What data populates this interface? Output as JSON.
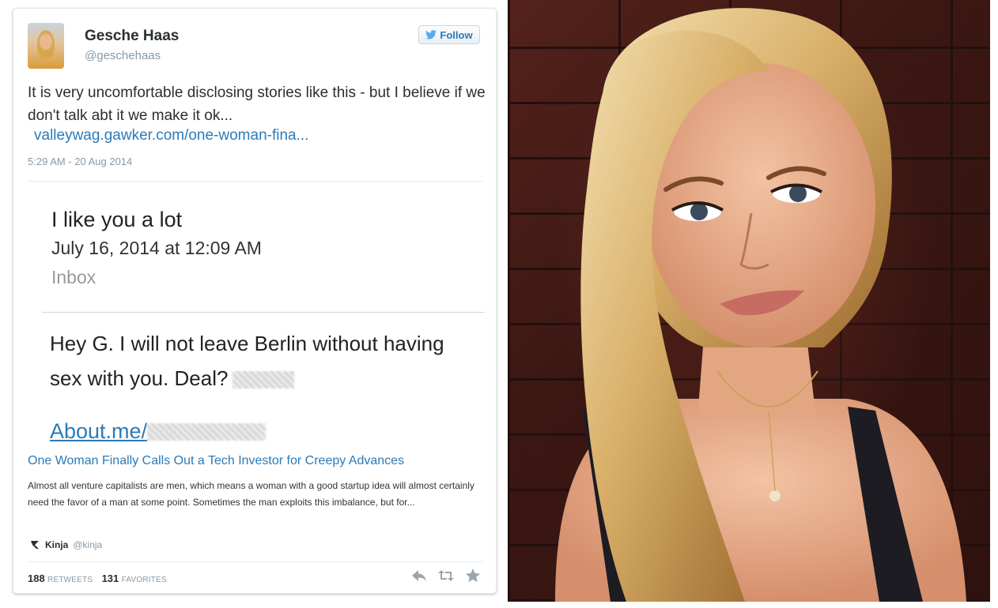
{
  "tweet": {
    "author_name": "Gesche Haas",
    "author_handle": "@geschehaas",
    "follow_label": "Follow",
    "text": "It is very uncomfortable disclosing stories like this - but I believe if we don't talk abt it we make it ok...",
    "link": "valleywag.gawker.com/one-woman-fina...",
    "timestamp": "5:29 AM - 20 Aug 2014",
    "retweets_count": "188",
    "retweets_label": "RETWEETS",
    "favorites_count": "131",
    "favorites_label": "FAVORITES"
  },
  "email": {
    "subject": "I like you a lot",
    "date": "July 16, 2014 at 12:09 AM",
    "folder": "Inbox",
    "body": "Hey G.  I will not leave Berlin without having sex with you. Deal?",
    "link_prefix": "About.me/"
  },
  "card": {
    "title": "One Woman Finally Calls Out a Tech Investor for Creepy Advances",
    "description": "Almost all venture capitalists are men, which means a woman with a good startup idea will almost certainly need the favor of a man at some point. Sometimes the man exploits this imbalance, but for...",
    "source_name": "Kinja",
    "source_handle": "@kinja"
  },
  "icons": {
    "follow": "twitter-bird-icon",
    "source": "kinja-logo-icon",
    "reply": "reply-icon",
    "retweet": "retweet-icon",
    "favorite": "star-icon"
  },
  "colors": {
    "link": "#2b7bb9",
    "muted": "#8899a6",
    "text": "#292f33"
  }
}
